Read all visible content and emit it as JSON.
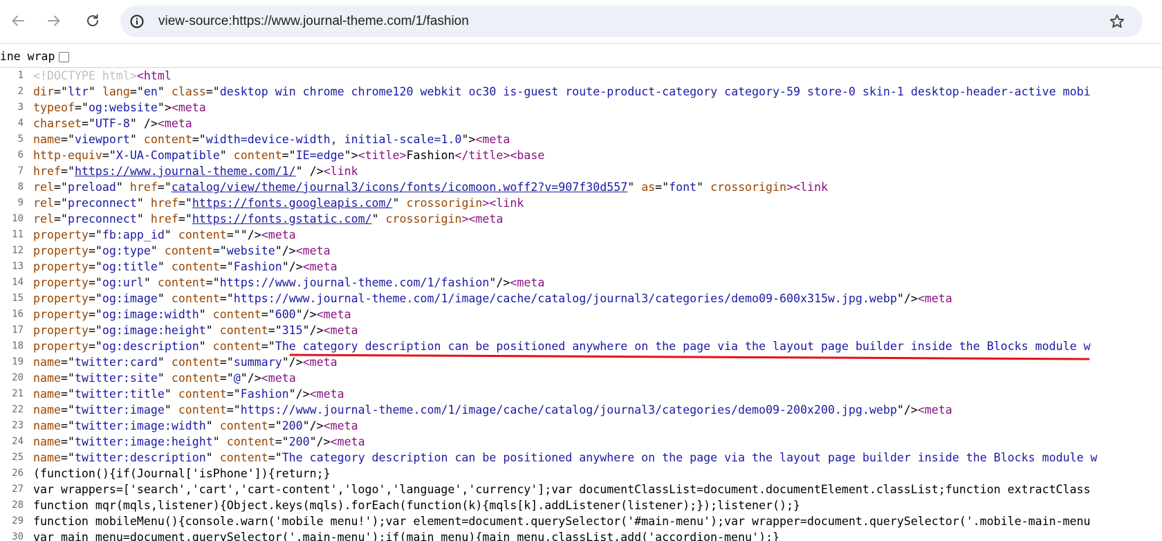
{
  "browser": {
    "url": "view-source:https://www.journal-theme.com/1/fashion",
    "back_icon": "arrow-left-icon",
    "forward_icon": "arrow-right-icon",
    "reload_icon": "reload-icon",
    "site_info_icon": "info-circle-icon",
    "bookmark_icon": "star-outline-icon"
  },
  "toolbar": {
    "line_wrap_label": "Line wrap",
    "line_wrap_checked": false
  },
  "colors": {
    "tag": "#881280",
    "attribute": "#994500",
    "value": "#1a1aa6",
    "doctype": "#c0c0c0",
    "annotation": "#e8101a"
  },
  "source_lines": [
    {
      "no": "1",
      "tokens": [
        [
          "doc",
          "<!DOCTYPE html>"
        ],
        [
          "tag",
          "<html"
        ]
      ]
    },
    {
      "no": "2",
      "tokens": [
        [
          "attr",
          "dir"
        ],
        [
          "txt",
          "=\""
        ],
        [
          "val",
          "ltr"
        ],
        [
          "txt",
          "\" "
        ],
        [
          "attr",
          "lang"
        ],
        [
          "txt",
          "=\""
        ],
        [
          "val",
          "en"
        ],
        [
          "txt",
          "\" "
        ],
        [
          "attr",
          "class"
        ],
        [
          "txt",
          "=\""
        ],
        [
          "val",
          "desktop win chrome chrome120 webkit oc30 is-guest route-product-category category-59 store-0 skin-1 desktop-header-active mobi"
        ]
      ]
    },
    {
      "no": "3",
      "tokens": [
        [
          "attr",
          "typeof"
        ],
        [
          "txt",
          "=\""
        ],
        [
          "val",
          "og:website"
        ],
        [
          "txt",
          "\">"
        ],
        [
          "tag",
          "<meta"
        ]
      ]
    },
    {
      "no": "4",
      "tokens": [
        [
          "attr",
          "charset"
        ],
        [
          "txt",
          "=\""
        ],
        [
          "val",
          "UTF-8"
        ],
        [
          "txt",
          "\" />"
        ],
        [
          "tag",
          "<meta"
        ]
      ]
    },
    {
      "no": "5",
      "tokens": [
        [
          "attr",
          "name"
        ],
        [
          "txt",
          "=\""
        ],
        [
          "val",
          "viewport"
        ],
        [
          "txt",
          "\" "
        ],
        [
          "attr",
          "content"
        ],
        [
          "txt",
          "=\""
        ],
        [
          "val",
          "width=device-width, initial-scale=1.0"
        ],
        [
          "txt",
          "\">"
        ],
        [
          "tag",
          "<meta"
        ]
      ]
    },
    {
      "no": "6",
      "tokens": [
        [
          "attr",
          "http-equiv"
        ],
        [
          "txt",
          "=\""
        ],
        [
          "val",
          "X-UA-Compatible"
        ],
        [
          "txt",
          "\" "
        ],
        [
          "attr",
          "content"
        ],
        [
          "txt",
          "=\""
        ],
        [
          "val",
          "IE=edge"
        ],
        [
          "txt",
          "\">"
        ],
        [
          "tag",
          "<title>"
        ],
        [
          "txt",
          "Fashion"
        ],
        [
          "tag",
          "</title><base"
        ]
      ]
    },
    {
      "no": "7",
      "tokens": [
        [
          "attr",
          "href"
        ],
        [
          "txt",
          "=\""
        ],
        [
          "link",
          "https://www.journal-theme.com/1/"
        ],
        [
          "txt",
          "\" />"
        ],
        [
          "tag",
          "<link"
        ]
      ]
    },
    {
      "no": "8",
      "tokens": [
        [
          "attr",
          "rel"
        ],
        [
          "txt",
          "=\""
        ],
        [
          "val",
          "preload"
        ],
        [
          "txt",
          "\" "
        ],
        [
          "attr",
          "href"
        ],
        [
          "txt",
          "=\""
        ],
        [
          "link",
          "catalog/view/theme/journal3/icons/fonts/icomoon.woff2?v=907f30d557"
        ],
        [
          "txt",
          "\" "
        ],
        [
          "attr",
          "as"
        ],
        [
          "txt",
          "=\""
        ],
        [
          "val",
          "font"
        ],
        [
          "txt",
          "\" "
        ],
        [
          "attr",
          "crossorigin"
        ],
        [
          "tag",
          "><link"
        ]
      ]
    },
    {
      "no": "9",
      "tokens": [
        [
          "attr",
          "rel"
        ],
        [
          "txt",
          "=\""
        ],
        [
          "val",
          "preconnect"
        ],
        [
          "txt",
          "\" "
        ],
        [
          "attr",
          "href"
        ],
        [
          "txt",
          "=\""
        ],
        [
          "link",
          "https://fonts.googleapis.com/"
        ],
        [
          "txt",
          "\" "
        ],
        [
          "attr",
          "crossorigin"
        ],
        [
          "tag",
          "><link"
        ]
      ]
    },
    {
      "no": "10",
      "tokens": [
        [
          "attr",
          "rel"
        ],
        [
          "txt",
          "=\""
        ],
        [
          "val",
          "preconnect"
        ],
        [
          "txt",
          "\" "
        ],
        [
          "attr",
          "href"
        ],
        [
          "txt",
          "=\""
        ],
        [
          "link",
          "https://fonts.gstatic.com/"
        ],
        [
          "txt",
          "\" "
        ],
        [
          "attr",
          "crossorigin"
        ],
        [
          "tag",
          "><meta"
        ]
      ]
    },
    {
      "no": "11",
      "tokens": [
        [
          "attr",
          "property"
        ],
        [
          "txt",
          "=\""
        ],
        [
          "val",
          "fb:app_id"
        ],
        [
          "txt",
          "\" "
        ],
        [
          "attr",
          "content"
        ],
        [
          "txt",
          "=\"\"/>"
        ],
        [
          "tag",
          "<meta"
        ]
      ]
    },
    {
      "no": "12",
      "tokens": [
        [
          "attr",
          "property"
        ],
        [
          "txt",
          "=\""
        ],
        [
          "val",
          "og:type"
        ],
        [
          "txt",
          "\" "
        ],
        [
          "attr",
          "content"
        ],
        [
          "txt",
          "=\""
        ],
        [
          "val",
          "website"
        ],
        [
          "txt",
          "\"/>"
        ],
        [
          "tag",
          "<meta"
        ]
      ]
    },
    {
      "no": "13",
      "tokens": [
        [
          "attr",
          "property"
        ],
        [
          "txt",
          "=\""
        ],
        [
          "val",
          "og:title"
        ],
        [
          "txt",
          "\" "
        ],
        [
          "attr",
          "content"
        ],
        [
          "txt",
          "=\""
        ],
        [
          "val",
          "Fashion"
        ],
        [
          "txt",
          "\"/>"
        ],
        [
          "tag",
          "<meta"
        ]
      ]
    },
    {
      "no": "14",
      "tokens": [
        [
          "attr",
          "property"
        ],
        [
          "txt",
          "=\""
        ],
        [
          "val",
          "og:url"
        ],
        [
          "txt",
          "\" "
        ],
        [
          "attr",
          "content"
        ],
        [
          "txt",
          "=\""
        ],
        [
          "val",
          "https://www.journal-theme.com/1/fashion"
        ],
        [
          "txt",
          "\"/>"
        ],
        [
          "tag",
          "<meta"
        ]
      ]
    },
    {
      "no": "15",
      "tokens": [
        [
          "attr",
          "property"
        ],
        [
          "txt",
          "=\""
        ],
        [
          "val",
          "og:image"
        ],
        [
          "txt",
          "\" "
        ],
        [
          "attr",
          "content"
        ],
        [
          "txt",
          "=\""
        ],
        [
          "val",
          "https://www.journal-theme.com/1/image/cache/catalog/journal3/categories/demo09-600x315w.jpg.webp"
        ],
        [
          "txt",
          "\"/>"
        ],
        [
          "tag",
          "<meta"
        ]
      ]
    },
    {
      "no": "16",
      "tokens": [
        [
          "attr",
          "property"
        ],
        [
          "txt",
          "=\""
        ],
        [
          "val",
          "og:image:width"
        ],
        [
          "txt",
          "\" "
        ],
        [
          "attr",
          "content"
        ],
        [
          "txt",
          "=\""
        ],
        [
          "val",
          "600"
        ],
        [
          "txt",
          "\"/>"
        ],
        [
          "tag",
          "<meta"
        ]
      ]
    },
    {
      "no": "17",
      "tokens": [
        [
          "attr",
          "property"
        ],
        [
          "txt",
          "=\""
        ],
        [
          "val",
          "og:image:height"
        ],
        [
          "txt",
          "\" "
        ],
        [
          "attr",
          "content"
        ],
        [
          "txt",
          "=\""
        ],
        [
          "val",
          "315"
        ],
        [
          "txt",
          "\"/>"
        ],
        [
          "tag",
          "<meta"
        ]
      ]
    },
    {
      "no": "18",
      "tokens": [
        [
          "attr",
          "property"
        ],
        [
          "txt",
          "=\""
        ],
        [
          "val",
          "og:description"
        ],
        [
          "txt",
          "\" "
        ],
        [
          "attr",
          "content"
        ],
        [
          "txt",
          "=\""
        ],
        [
          "val",
          "The category description can be positioned anywhere on the page via the layout page builder inside the Blocks module w"
        ]
      ]
    },
    {
      "no": "19",
      "tokens": [
        [
          "attr",
          "name"
        ],
        [
          "txt",
          "=\""
        ],
        [
          "val",
          "twitter:card"
        ],
        [
          "txt",
          "\" "
        ],
        [
          "attr",
          "content"
        ],
        [
          "txt",
          "=\""
        ],
        [
          "val",
          "summary"
        ],
        [
          "txt",
          "\"/>"
        ],
        [
          "tag",
          "<meta"
        ]
      ]
    },
    {
      "no": "20",
      "tokens": [
        [
          "attr",
          "name"
        ],
        [
          "txt",
          "=\""
        ],
        [
          "val",
          "twitter:site"
        ],
        [
          "txt",
          "\" "
        ],
        [
          "attr",
          "content"
        ],
        [
          "txt",
          "=\""
        ],
        [
          "val",
          "@"
        ],
        [
          "txt",
          "\"/>"
        ],
        [
          "tag",
          "<meta"
        ]
      ]
    },
    {
      "no": "21",
      "tokens": [
        [
          "attr",
          "name"
        ],
        [
          "txt",
          "=\""
        ],
        [
          "val",
          "twitter:title"
        ],
        [
          "txt",
          "\" "
        ],
        [
          "attr",
          "content"
        ],
        [
          "txt",
          "=\""
        ],
        [
          "val",
          "Fashion"
        ],
        [
          "txt",
          "\"/>"
        ],
        [
          "tag",
          "<meta"
        ]
      ]
    },
    {
      "no": "22",
      "tokens": [
        [
          "attr",
          "name"
        ],
        [
          "txt",
          "=\""
        ],
        [
          "val",
          "twitter:image"
        ],
        [
          "txt",
          "\" "
        ],
        [
          "attr",
          "content"
        ],
        [
          "txt",
          "=\""
        ],
        [
          "val",
          "https://www.journal-theme.com/1/image/cache/catalog/journal3/categories/demo09-200x200.jpg.webp"
        ],
        [
          "txt",
          "\"/>"
        ],
        [
          "tag",
          "<meta"
        ]
      ]
    },
    {
      "no": "23",
      "tokens": [
        [
          "attr",
          "name"
        ],
        [
          "txt",
          "=\""
        ],
        [
          "val",
          "twitter:image:width"
        ],
        [
          "txt",
          "\" "
        ],
        [
          "attr",
          "content"
        ],
        [
          "txt",
          "=\""
        ],
        [
          "val",
          "200"
        ],
        [
          "txt",
          "\"/>"
        ],
        [
          "tag",
          "<meta"
        ]
      ]
    },
    {
      "no": "24",
      "tokens": [
        [
          "attr",
          "name"
        ],
        [
          "txt",
          "=\""
        ],
        [
          "val",
          "twitter:image:height"
        ],
        [
          "txt",
          "\" "
        ],
        [
          "attr",
          "content"
        ],
        [
          "txt",
          "=\""
        ],
        [
          "val",
          "200"
        ],
        [
          "txt",
          "\"/>"
        ],
        [
          "tag",
          "<meta"
        ]
      ]
    },
    {
      "no": "25",
      "tokens": [
        [
          "attr",
          "name"
        ],
        [
          "txt",
          "=\""
        ],
        [
          "val",
          "twitter:description"
        ],
        [
          "txt",
          "\" "
        ],
        [
          "attr",
          "content"
        ],
        [
          "txt",
          "=\""
        ],
        [
          "val",
          "The category description can be positioned anywhere on the page via the layout page builder inside the Blocks module w"
        ]
      ]
    },
    {
      "no": "26",
      "tokens": [
        [
          "txt",
          "(function(){if(Journal['isPhone']){return;}"
        ]
      ]
    },
    {
      "no": "27",
      "tokens": [
        [
          "txt",
          "var wrappers=['search','cart','cart-content','logo','language','currency'];var documentClassList=document.documentElement.classList;function extractClass"
        ]
      ]
    },
    {
      "no": "28",
      "tokens": [
        [
          "txt",
          "function mqr(mqls,listener){Object.keys(mqls).forEach(function(k){mqls[k].addListener(listener);});listener();}"
        ]
      ]
    },
    {
      "no": "29",
      "tokens": [
        [
          "txt",
          "function mobileMenu(){console.warn('mobile menu!');var element=document.querySelector('#main-menu');var wrapper=document.querySelector('.mobile-main-menu"
        ]
      ]
    },
    {
      "no": "30",
      "tokens": [
        [
          "txt",
          "var main_menu=document.querySelector('.main-menu');if(main_menu){main_menu.classList.add('accordion-menu');}"
        ]
      ]
    }
  ]
}
